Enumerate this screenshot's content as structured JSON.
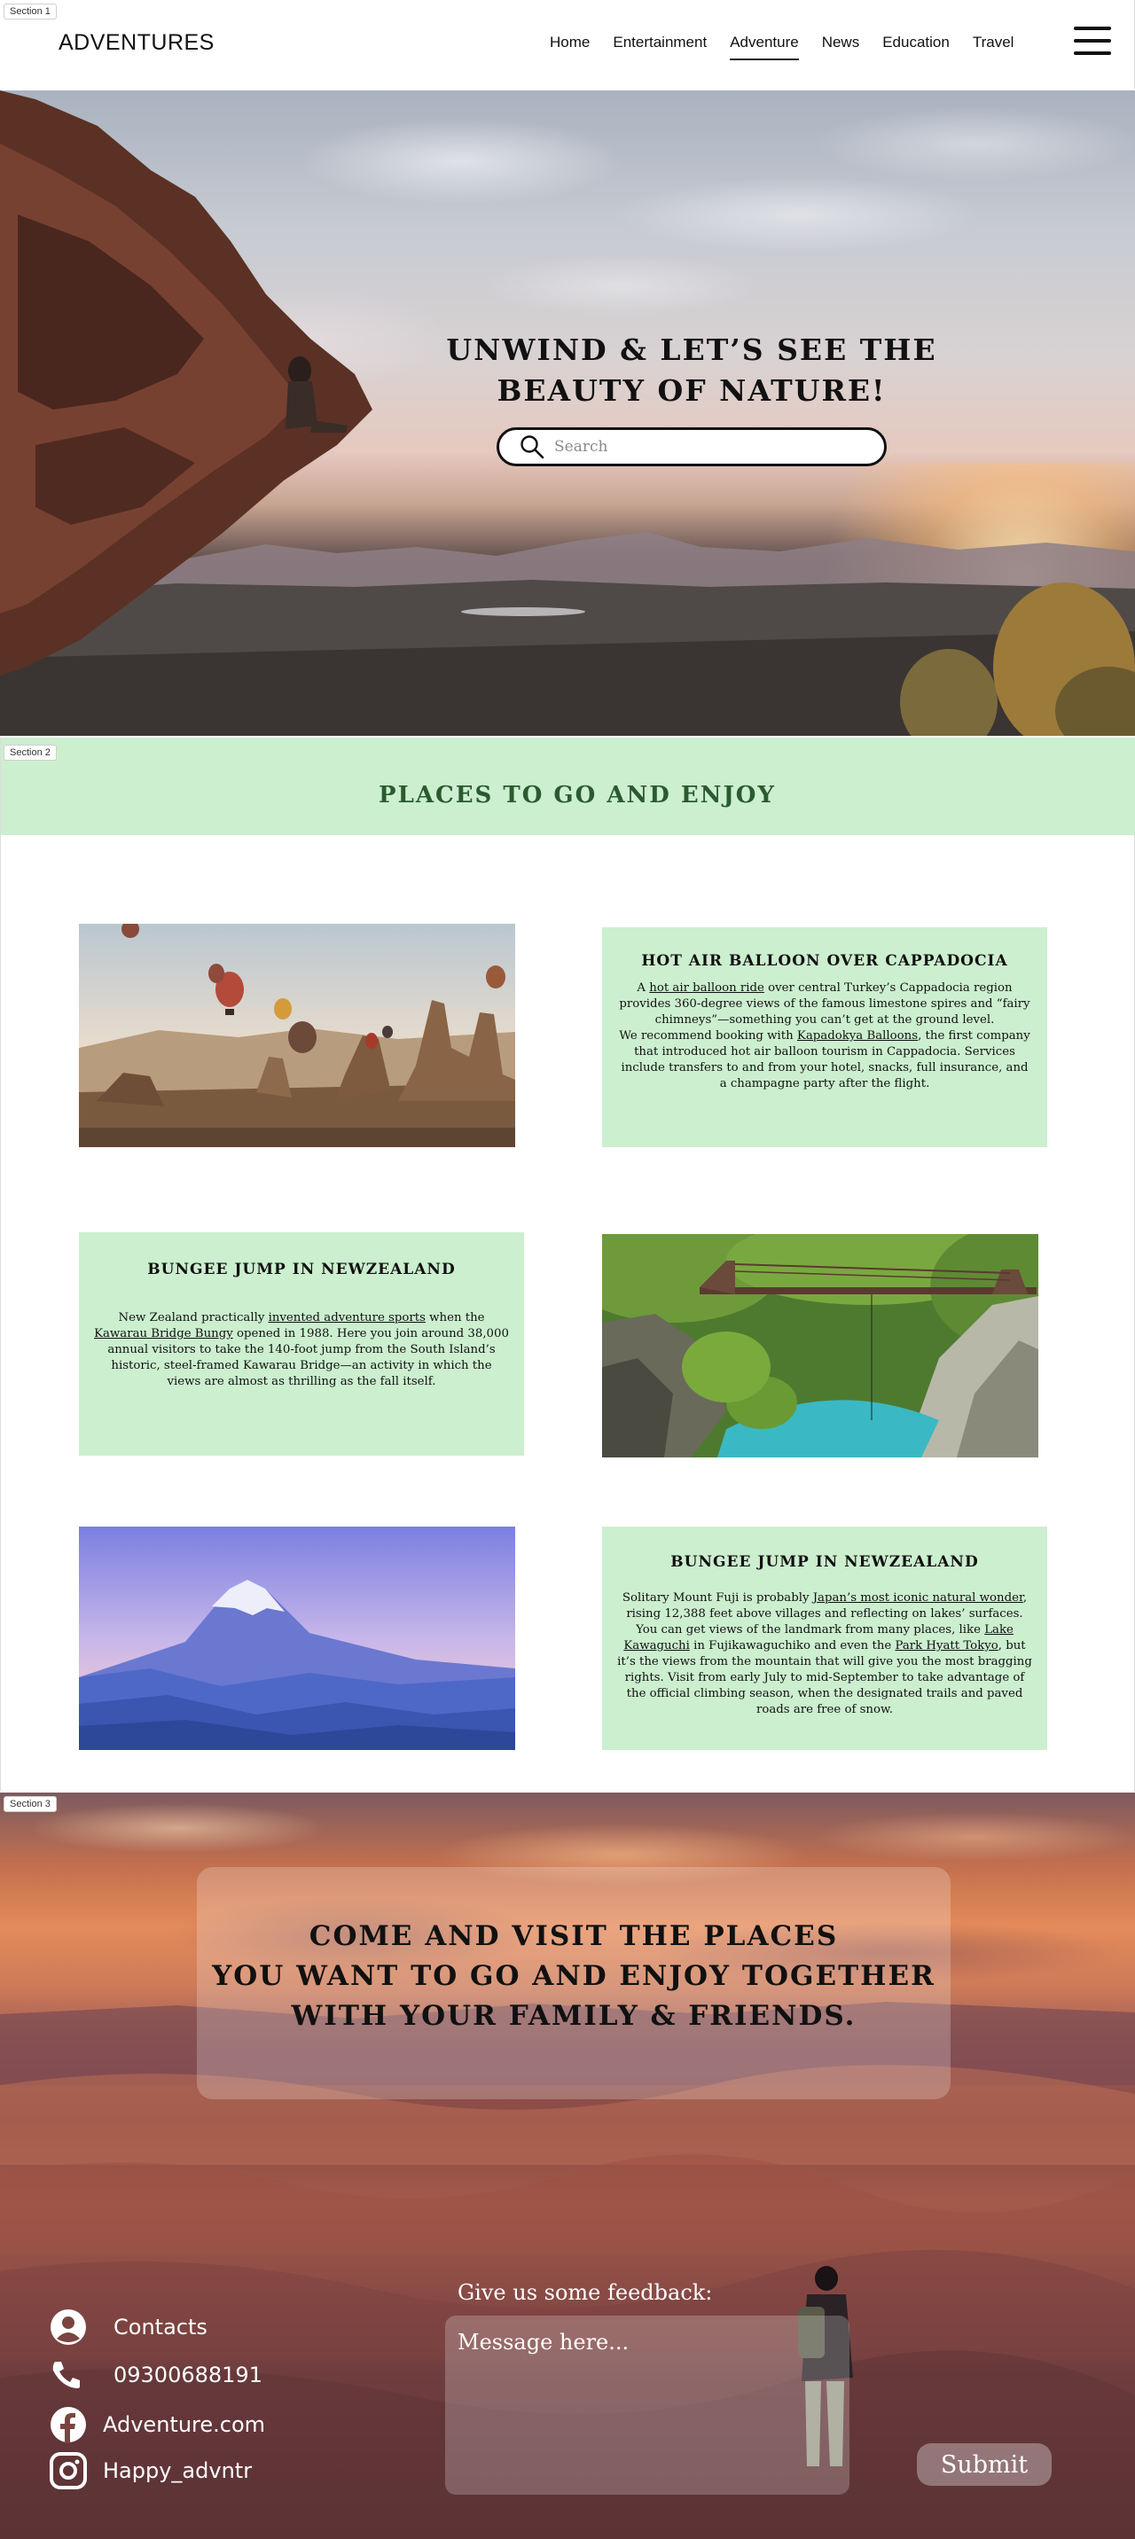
{
  "section_tags": {
    "s1": "Section 1",
    "s2": "Section 2",
    "s3": "Section 3"
  },
  "header": {
    "brand": "ADVENTURES",
    "nav": [
      "Home",
      "Entertainment",
      "Adventure",
      "News",
      "Education",
      "Travel"
    ],
    "active_nav": "Adventure",
    "menu_icon": "hamburger-menu-icon"
  },
  "hero": {
    "title_line1": "UNWIND & LET’S SEE THE",
    "title_line2": "BEAUTY OF NATURE!",
    "search": {
      "placeholder": "Search",
      "icon": "search-icon"
    }
  },
  "places": {
    "title": "PLACES TO GO AND ENJOY",
    "cards": [
      {
        "title": "HOT AIR BALLOON OVER CAPPADOCIA",
        "t1": "A ",
        "l1": "hot air balloon ride",
        "t2": " over central Turkey’s Cappadocia region provides 360-degree views of the famous limestone spires and “fairy chimneys”—something you can’t get at the ground level.",
        "t3": "We recommend booking with ",
        "l2": "Kapadokya Balloons",
        "t4": ", the first company that introduced hot air balloon tourism in Cappadocia. Services include transfers to and from your hotel, snacks, full insurance, and a champagne party after the flight."
      },
      {
        "title": "BUNGEE JUMP IN NEWZEALAND",
        "t1": "New Zealand practically ",
        "l1": "invented adventure sports",
        "t2": " when the ",
        "l2": "Kawarau Bridge Bungy",
        "t3": " opened in 1988. Here you join around 38,000 annual visitors to take the 140-foot jump from the South Island’s historic, steel-framed Kawarau Bridge—an activity in which the views are almost as thrilling as the fall itself."
      },
      {
        "title": "BUNGEE JUMP IN NEWZEALAND",
        "t1": "Solitary Mount Fuji is probably ",
        "l1": "Japan’s most iconic natural wonder",
        "t2": ", rising 12,388 feet above villages and reflecting on lakes’ surfaces. You can get views of the landmark from many places, like ",
        "l2": "Lake Kawaguchi",
        "t3": " in Fujikawaguchiko and even the ",
        "l3": "Park Hyatt Tokyo",
        "t4": ", but it’s the views from the mountain that will give you the most bragging rights. Visit from early July to mid-September to take advantage of the official climbing season, when the designated trails and paved roads are free of snow."
      }
    ]
  },
  "visit": {
    "line1": "COME AND VISIT THE PLACES",
    "line2": "YOU WANT TO GO AND ENJOY TOGETHER",
    "line3": "WITH  YOUR FAMILY & FRIENDS."
  },
  "contacts": {
    "items": [
      {
        "icon": "user-circle-icon",
        "text": "Contacts"
      },
      {
        "icon": "phone-icon",
        "text": "09300688191"
      },
      {
        "icon": "facebook-icon",
        "text": "Adventure.com"
      },
      {
        "icon": "instagram-icon",
        "text": "Happy_advntr"
      }
    ]
  },
  "feedback": {
    "label": "Give us some feedback:",
    "placeholder": "Message here...",
    "submit_label": "Submit"
  },
  "colors": {
    "banner_green": "#ccefcf",
    "title_green": "#2b5a30",
    "text_dark": "#111111"
  }
}
